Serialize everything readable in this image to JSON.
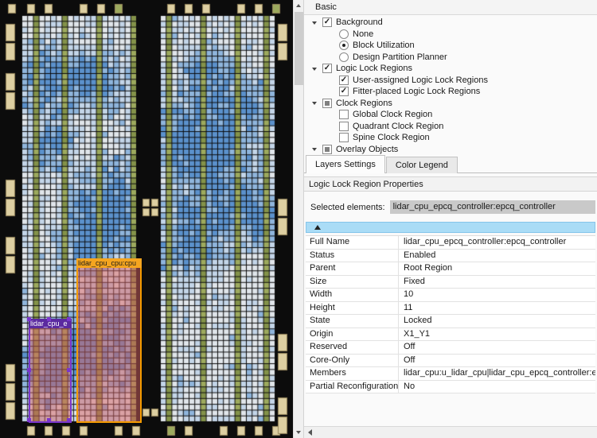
{
  "chip": {
    "palette": {
      "bg": "#0c0c0c",
      "cell_empty": "#e0e5ea",
      "cell_low": "#c3d5e8",
      "cell_mid": "#8fb5dc",
      "cell_high": "#5b91cc",
      "green": "#9daa5e",
      "green_dark": "#84934a",
      "io": "#ddcfa2",
      "io_border": "#97875c",
      "region_fill": "rgba(214,96,96,0.5)"
    },
    "regions": [
      {
        "id": "cpu",
        "label": "lidar_cpu_cpu:cpu",
        "border": "#f59b00",
        "label_bg": "#f5a51f",
        "label_color": "#1a1a1a"
      },
      {
        "id": "epcq",
        "label": "lidar_cpu_e",
        "border": "#7a36cc",
        "label_bg": "#5b2aa0",
        "label_color": "#ffffff"
      }
    ]
  },
  "panel": {
    "header": "Basic",
    "tree": [
      {
        "label": "Background",
        "type": "checkbox",
        "checked": true,
        "expanded": true,
        "level": 0
      },
      {
        "label": "None",
        "type": "radio",
        "checked": false,
        "level": 1
      },
      {
        "label": "Block Utilization",
        "type": "radio",
        "checked": true,
        "level": 1
      },
      {
        "label": "Design Partition Planner",
        "type": "radio",
        "checked": false,
        "level": 1
      },
      {
        "label": "Logic Lock Regions",
        "type": "checkbox",
        "checked": true,
        "expanded": true,
        "level": 0
      },
      {
        "label": "User-assigned Logic Lock Regions",
        "type": "checkbox",
        "checked": true,
        "level": 1
      },
      {
        "label": "Fitter-placed Logic Lock Regions",
        "type": "checkbox",
        "checked": true,
        "level": 1
      },
      {
        "label": "Clock Regions",
        "type": "checkbox",
        "checked": "partial",
        "expanded": true,
        "level": 0
      },
      {
        "label": "Global Clock Region",
        "type": "checkbox",
        "checked": false,
        "level": 1
      },
      {
        "label": "Quadrant Clock Region",
        "type": "checkbox",
        "checked": false,
        "level": 1
      },
      {
        "label": "Spine Clock Region",
        "type": "checkbox",
        "checked": false,
        "level": 1
      },
      {
        "label": "Overlay Objects",
        "type": "checkbox",
        "checked": "partial",
        "expanded": true,
        "level": 0
      }
    ],
    "tabs": [
      {
        "label": "Layers Settings",
        "active": true
      },
      {
        "label": "Color Legend",
        "active": false
      }
    ],
    "properties_title": "Logic Lock Region Properties",
    "selected_elements_label": "Selected elements:",
    "selected_element": "lidar_cpu_epcq_controller:epcq_controller",
    "properties": [
      {
        "name": "Full Name",
        "value": "lidar_cpu_epcq_controller:epcq_controller"
      },
      {
        "name": "Status",
        "value": "Enabled"
      },
      {
        "name": "Parent",
        "value": "Root Region"
      },
      {
        "name": "Size",
        "value": "Fixed"
      },
      {
        "name": "Width",
        "value": "10"
      },
      {
        "name": "Height",
        "value": "11"
      },
      {
        "name": "State",
        "value": "Locked"
      },
      {
        "name": "Origin",
        "value": "X1_Y1"
      },
      {
        "name": "Reserved",
        "value": "Off"
      },
      {
        "name": "Core-Only",
        "value": "Off"
      },
      {
        "name": "Members",
        "value": "lidar_cpu:u_lidar_cpu|lidar_cpu_epcq_controller:epcq_controller"
      },
      {
        "name": "Partial Reconfiguration",
        "value": "No"
      }
    ]
  }
}
